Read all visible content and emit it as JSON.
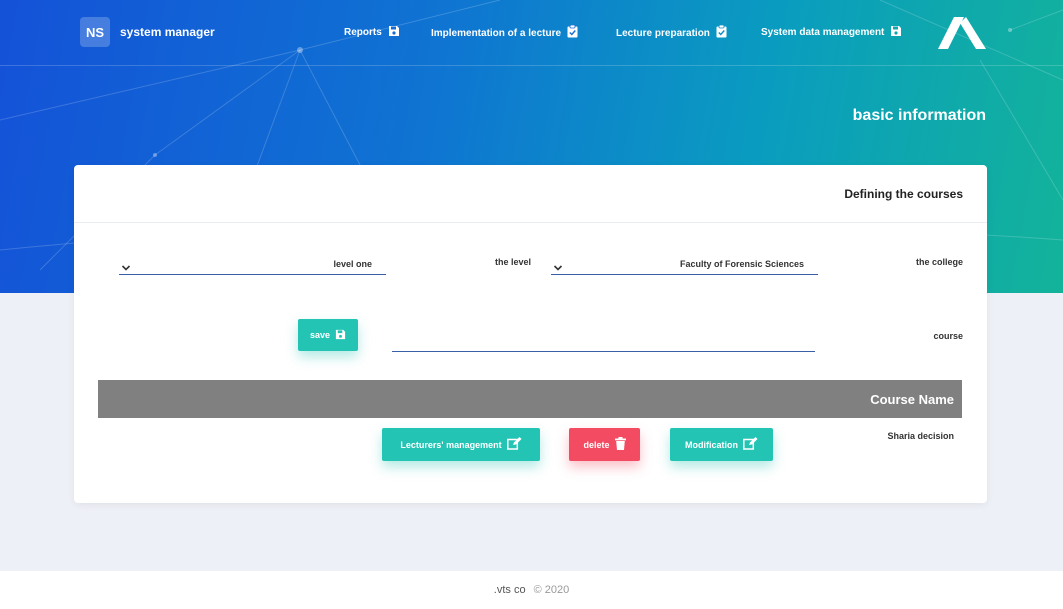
{
  "header": {
    "logo_text": "NS",
    "app_name": "system manager",
    "nav": [
      {
        "label": "Reports",
        "icon": "floppy-disk-icon"
      },
      {
        "label": "Implementation of a lecture",
        "icon": "clipboard-check-icon"
      },
      {
        "label": "Lecture preparation",
        "icon": "clipboard-check-icon"
      },
      {
        "label": "System data management",
        "icon": "floppy-disk-icon"
      }
    ],
    "page_title": "basic information"
  },
  "card": {
    "title": "Defining the courses",
    "college": {
      "label": "the college",
      "value": "Faculty of Forensic Sciences"
    },
    "level": {
      "label": "the level",
      "value": "level one"
    },
    "course": {
      "label": "course",
      "value": ""
    },
    "save_label": "save"
  },
  "table": {
    "columns": [
      "Course Name"
    ],
    "rows": [
      {
        "course_name": "Sharia decision",
        "actions": [
          "Modification",
          "delete",
          "Lecturers' management"
        ]
      }
    ]
  },
  "footer": {
    "company": ".vts co",
    "copyright": "© 2020"
  },
  "colors": {
    "accent": "#24c4b5",
    "danger": "#f24b62",
    "table_head": "#808080",
    "hero_start": "#1452d8",
    "hero_end": "#13b39a"
  }
}
